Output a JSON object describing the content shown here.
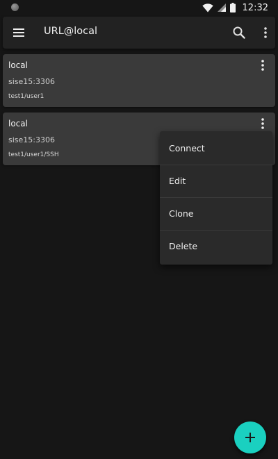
{
  "status_bar": {
    "time": "12:32",
    "icons": [
      "notification-dot-icon",
      "wifi-icon",
      "signal-icon",
      "battery-icon"
    ]
  },
  "app_bar": {
    "title": "URL@local",
    "icons": [
      "menu-icon",
      "search-icon",
      "more-vert-icon"
    ]
  },
  "connections": [
    {
      "name": "local",
      "host": "sise15:3306",
      "auth": "test1/user1"
    },
    {
      "name": "local",
      "host": "sise15:3306",
      "auth": "test1/user1/SSH"
    }
  ],
  "context_menu": {
    "items": [
      {
        "label": "Connect"
      },
      {
        "label": "Edit"
      },
      {
        "label": "Clone"
      },
      {
        "label": "Delete"
      }
    ]
  },
  "fab": {
    "icon": "add-icon"
  },
  "colors": {
    "background": "#161616",
    "app_bar": "#222222",
    "card": "#3a3a3a",
    "menu": "#2a2a2a",
    "accent": "#1ad0c0"
  }
}
